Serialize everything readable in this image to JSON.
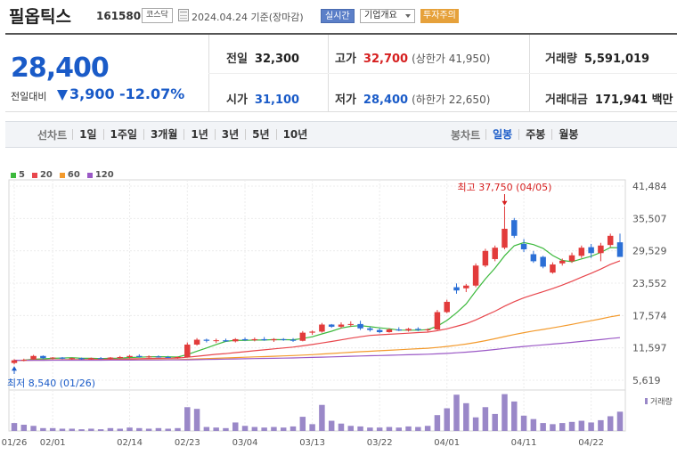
{
  "header": {
    "stock_name": "필옵틱스",
    "stock_code": "161580",
    "market_badge": "코스닥",
    "date_label": "2024.04.24 기준(장마감)",
    "realtime_button": "실시간",
    "corp_info_dropdown": "기업개요",
    "warning_badge": "투자주의"
  },
  "price": {
    "current": "28,400",
    "change_label": "전일대비",
    "change_value": "3,900",
    "change_pct": "-12.07%"
  },
  "stats": {
    "prev_close_label": "전일",
    "prev_close": "32,300",
    "open_label": "시가",
    "open": "31,100",
    "high_label": "고가",
    "high": "32,700",
    "upper_limit": "(상한가 41,950)",
    "low_label": "저가",
    "low": "28,400",
    "lower_limit": "(하한가 22,650)",
    "volume_label": "거래량",
    "volume": "5,591,019",
    "amount_label": "거래대금",
    "amount": "171,941 백만"
  },
  "toolbar": {
    "line_title": "선차트",
    "line_periods": [
      "1일",
      "1주일",
      "3개월",
      "1년",
      "3년",
      "5년",
      "10년"
    ],
    "candle_title": "봉차트",
    "candle_periods": [
      "일봉",
      "주봉",
      "월봉"
    ],
    "candle_active": "일봉"
  },
  "chart_data": {
    "type": "candlestick",
    "legend": [
      {
        "label": "5",
        "color": "#3cb93c"
      },
      {
        "label": "20",
        "color": "#e8474d"
      },
      {
        "label": "60",
        "color": "#f39a2c"
      },
      {
        "label": "120",
        "color": "#9b59c6"
      }
    ],
    "y_ticks": [
      "41,484",
      "35,507",
      "29,529",
      "23,552",
      "17,574",
      "11,597",
      "5,619"
    ],
    "y_tick_values": [
      41484,
      35507,
      29529,
      23552,
      17574,
      11597,
      5619
    ],
    "x_ticks": [
      "01/26",
      "02/01",
      "02/14",
      "02/23",
      "03/04",
      "03/13",
      "03/22",
      "04/01",
      "04/11",
      "04/22"
    ],
    "x_tick_index": [
      0,
      4,
      12,
      18,
      24,
      31,
      38,
      45,
      53,
      60
    ],
    "high_annotation": "최고 37,750 (04/05)",
    "low_annotation": "최저 8,540 (01/26)",
    "volume_label": "거래량",
    "up_color": "#e23b3b",
    "down_color": "#2b6fd6",
    "candles": [
      [
        8800,
        9500,
        8540,
        9300
      ],
      [
        9300,
        9600,
        9100,
        9400
      ],
      [
        9500,
        10300,
        9400,
        10100
      ],
      [
        10100,
        10200,
        9500,
        9700
      ],
      [
        9700,
        9900,
        9500,
        9800
      ],
      [
        9800,
        9900,
        9500,
        9600
      ],
      [
        9600,
        9800,
        9400,
        9700
      ],
      [
        9700,
        9800,
        9400,
        9500
      ],
      [
        9500,
        9800,
        9400,
        9700
      ],
      [
        9700,
        9900,
        9500,
        9600
      ],
      [
        9600,
        9900,
        9400,
        9800
      ],
      [
        9800,
        10100,
        9600,
        9900
      ],
      [
        9900,
        10300,
        9700,
        10100
      ],
      [
        10100,
        10400,
        9800,
        9900
      ],
      [
        9900,
        10200,
        9700,
        10000
      ],
      [
        10000,
        10200,
        9800,
        9900
      ],
      [
        9900,
        10100,
        9700,
        9800
      ],
      [
        9800,
        10000,
        9600,
        9900
      ],
      [
        9900,
        12600,
        9800,
        12200
      ],
      [
        12200,
        13400,
        12000,
        13100
      ],
      [
        13100,
        13300,
        12600,
        12900
      ],
      [
        12900,
        13300,
        12500,
        13000
      ],
      [
        13000,
        13300,
        12700,
        12800
      ],
      [
        12800,
        13400,
        12600,
        13200
      ],
      [
        13200,
        13500,
        12900,
        13000
      ],
      [
        13000,
        13500,
        12800,
        13200
      ],
      [
        13200,
        13600,
        12900,
        13000
      ],
      [
        13000,
        13400,
        12700,
        13200
      ],
      [
        13200,
        13400,
        12900,
        13100
      ],
      [
        13100,
        13400,
        12700,
        12900
      ],
      [
        12900,
        14700,
        12800,
        14400
      ],
      [
        14400,
        14800,
        14000,
        14600
      ],
      [
        14600,
        16200,
        14400,
        15900
      ],
      [
        15900,
        16000,
        15300,
        15500
      ],
      [
        15500,
        16300,
        15200,
        15900
      ],
      [
        15900,
        16500,
        15500,
        16000
      ],
      [
        16000,
        16600,
        14900,
        15200
      ],
      [
        15200,
        15500,
        14600,
        14900
      ],
      [
        14900,
        15200,
        14300,
        14500
      ],
      [
        14500,
        15200,
        14400,
        15000
      ],
      [
        15000,
        15400,
        14700,
        14800
      ],
      [
        14800,
        15300,
        14600,
        15100
      ],
      [
        15100,
        15400,
        14700,
        14900
      ],
      [
        14900,
        15200,
        14600,
        15000
      ],
      [
        15000,
        18600,
        14900,
        18200
      ],
      [
        18200,
        20500,
        18000,
        20100
      ],
      [
        22800,
        23500,
        21600,
        22200
      ],
      [
        22600,
        23400,
        21900,
        23100
      ],
      [
        23100,
        27200,
        22800,
        26800
      ],
      [
        26800,
        29900,
        26500,
        29500
      ],
      [
        28000,
        30500,
        27600,
        30100
      ],
      [
        30100,
        37750,
        29800,
        33600
      ],
      [
        35200,
        35600,
        31900,
        32300
      ],
      [
        30800,
        31700,
        29300,
        29800
      ],
      [
        28900,
        29500,
        27300,
        27600
      ],
      [
        28400,
        28600,
        26300,
        26600
      ],
      [
        25500,
        27400,
        25300,
        27000
      ],
      [
        27200,
        28100,
        26800,
        27700
      ],
      [
        27600,
        29200,
        27300,
        28700
      ],
      [
        28600,
        30500,
        28200,
        30100
      ],
      [
        30200,
        30800,
        28200,
        29100
      ],
      [
        29100,
        31000,
        27600,
        30500
      ],
      [
        30600,
        32700,
        30200,
        32300
      ],
      [
        31100,
        32700,
        28400,
        28400
      ]
    ],
    "volume": [
      1.4,
      1.1,
      0.9,
      0.5,
      0.5,
      0.4,
      0.4,
      0.3,
      0.4,
      0.3,
      0.5,
      0.4,
      0.6,
      0.5,
      0.4,
      0.5,
      0.4,
      0.5,
      4.2,
      3.9,
      0.7,
      0.6,
      0.5,
      1.5,
      0.9,
      0.7,
      0.6,
      0.7,
      0.6,
      0.8,
      2.5,
      1.2,
      4.6,
      1.8,
      1.3,
      0.9,
      0.8,
      0.6,
      0.6,
      0.7,
      0.6,
      0.8,
      0.7,
      0.9,
      2.8,
      4.0,
      6.4,
      4.9,
      2.4,
      4.2,
      3.0,
      6.5,
      5.2,
      2.7,
      2.1,
      1.4,
      1.2,
      1.4,
      1.6,
      1.8,
      1.5,
      1.9,
      2.6,
      3.4
    ],
    "volume_max": 6.6
  }
}
